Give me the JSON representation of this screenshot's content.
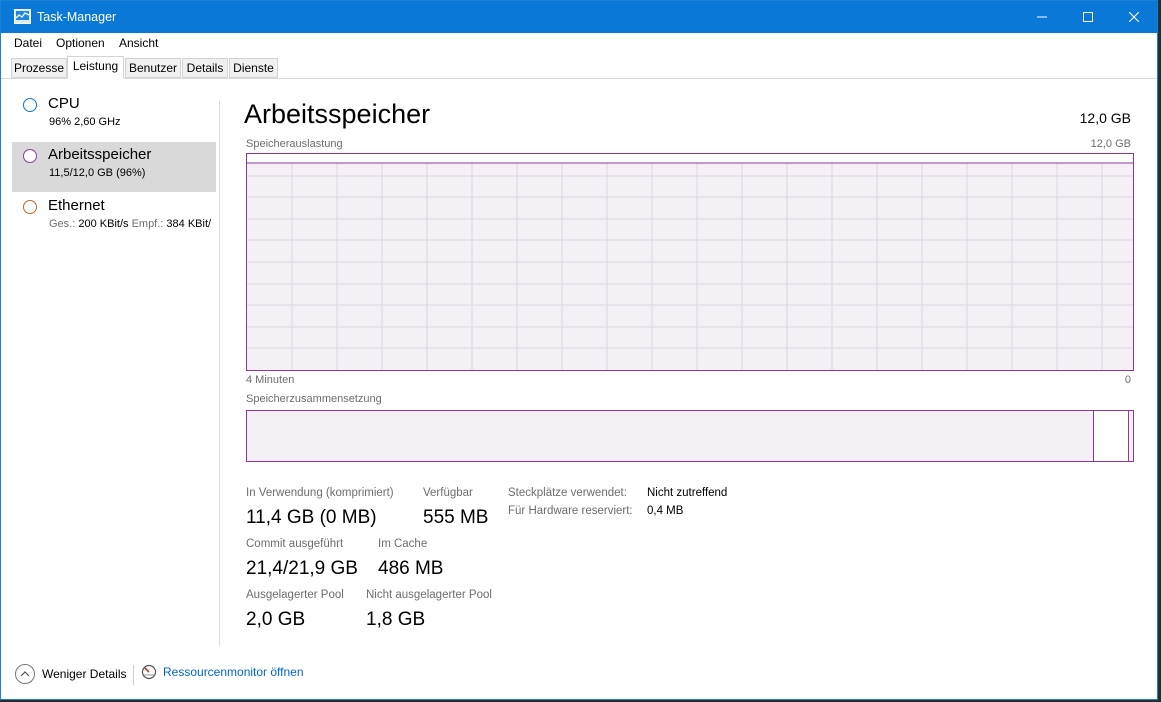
{
  "window": {
    "title": "Task-Manager",
    "controls": {
      "minimize": "—",
      "maximize": "☐",
      "close": "✕"
    }
  },
  "menu": [
    "Datei",
    "Optionen",
    "Ansicht"
  ],
  "tabs": [
    {
      "label": "Prozesse",
      "active": false
    },
    {
      "label": "Leistung",
      "active": true
    },
    {
      "label": "Benutzer",
      "active": false
    },
    {
      "label": "Details",
      "active": false
    },
    {
      "label": "Dienste",
      "active": false
    }
  ],
  "sidebar": {
    "items": [
      {
        "name": "CPU",
        "subtitle": "96%  2,60 GHz",
        "color": "#1174c4",
        "selected": false
      },
      {
        "name": "Arbeitsspeicher",
        "subtitle": "11,5/12,0 GB (96%)",
        "color": "#8b3a9c",
        "selected": true
      },
      {
        "name": "Ethernet",
        "sub_send_label": "Ges.:",
        "sub_send_value": "200 KBit/s",
        "sub_recv_label": "Empf.:",
        "sub_recv_value": "384 KBit/",
        "color": "#b46a2c",
        "selected": false
      }
    ]
  },
  "main": {
    "title": "Arbeitsspeicher",
    "total": "12,0 GB",
    "graph": {
      "label": "Speicherauslastung",
      "max_label": "12,0 GB",
      "time_left": "4 Minuten",
      "time_right": "0",
      "accent_color": "#8b3a9c",
      "usage_fraction": 0.96
    },
    "composition": {
      "label": "Speicherzusammensetzung",
      "in_use_fraction": 0.955,
      "free_fraction": 0.04
    },
    "stats": {
      "in_use_label": "In Verwendung (komprimiert)",
      "in_use_value": "11,4 GB (0 MB)",
      "available_label": "Verfügbar",
      "available_value": "555 MB",
      "committed_label": "Commit ausgeführt",
      "committed_value": "21,4/21,9 GB",
      "cached_label": "Im Cache",
      "cached_value": "486 MB",
      "paged_pool_label": "Ausgelagerter Pool",
      "paged_pool_value": "2,0 GB",
      "nonpaged_pool_label": "Nicht ausgelagerter Pool",
      "nonpaged_pool_value": "1,8 GB",
      "slots_label": "Steckplätze verwendet:",
      "slots_value": "Nicht zutreffend",
      "hw_reserved_label": "Für Hardware reserviert:",
      "hw_reserved_value": "0,4 MB"
    }
  },
  "footer": {
    "less_details": "Weniger Details",
    "resource_monitor": "Ressourcenmonitor öffnen"
  }
}
